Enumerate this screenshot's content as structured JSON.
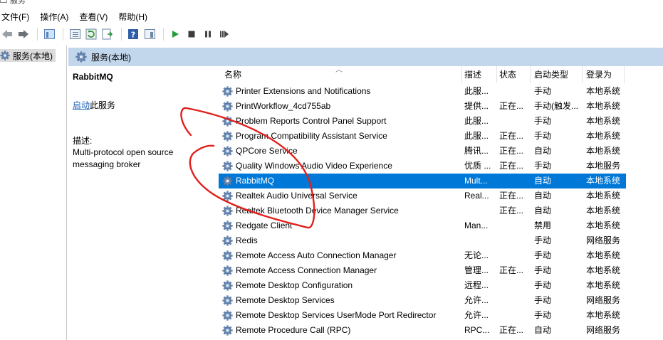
{
  "window": {
    "title_fragment": "服务"
  },
  "menu": [
    {
      "label": "文件(F)"
    },
    {
      "label": "操作(A)"
    },
    {
      "label": "查看(V)"
    },
    {
      "label": "帮助(H)"
    }
  ],
  "toolbar": {
    "buttons": [
      "back-icon",
      "forward-icon",
      "show-hide-tree-icon",
      "properties-icon",
      "refresh-icon",
      "export-list-icon",
      "help-icon",
      "show-action-pane-icon",
      "start-service-icon",
      "stop-service-icon",
      "pause-service-icon",
      "restart-service-icon"
    ]
  },
  "tree": {
    "item_label": "服务(本地)"
  },
  "main": {
    "header_label": "服务(本地)"
  },
  "detail": {
    "service_name": "RabbitMQ",
    "start_link": "启动",
    "start_suffix": "此服务",
    "description_label": "描述:",
    "description": "Multi-protocol open source messaging broker"
  },
  "table": {
    "columns": [
      {
        "label": "名称"
      },
      {
        "label": "描述"
      },
      {
        "label": "状态"
      },
      {
        "label": "启动类型"
      },
      {
        "label": "登录为"
      }
    ],
    "selected_index": 6,
    "rows": [
      {
        "name": "Printer Extensions and Notifications",
        "desc": "此服...",
        "status": "",
        "startup": "手动",
        "logon": "本地系统"
      },
      {
        "name": "PrintWorkflow_4cd755ab",
        "desc": "提供...",
        "status": "正在...",
        "startup": "手动(触发...",
        "logon": "本地系统"
      },
      {
        "name": "Problem Reports Control Panel Support",
        "desc": "此服...",
        "status": "",
        "startup": "手动",
        "logon": "本地系统"
      },
      {
        "name": "Program Compatibility Assistant Service",
        "desc": "此服...",
        "status": "正在...",
        "startup": "手动",
        "logon": "本地系统"
      },
      {
        "name": "QPCore Service",
        "desc": "腾讯...",
        "status": "正在...",
        "startup": "自动",
        "logon": "本地系统"
      },
      {
        "name": "Quality Windows Audio Video Experience",
        "desc": "优质 ...",
        "status": "正在...",
        "startup": "手动",
        "logon": "本地服务"
      },
      {
        "name": "RabbitMQ",
        "desc": "Mult...",
        "status": "",
        "startup": "自动",
        "logon": "本地系统"
      },
      {
        "name": "Realtek Audio Universal Service",
        "desc": "Real...",
        "status": "正在...",
        "startup": "自动",
        "logon": "本地系统"
      },
      {
        "name": "Realtek Bluetooth Device Manager Service",
        "desc": "",
        "status": "正在...",
        "startup": "自动",
        "logon": "本地系统"
      },
      {
        "name": "Redgate Client",
        "desc": "Man...",
        "status": "",
        "startup": "禁用",
        "logon": "本地系统"
      },
      {
        "name": "Redis",
        "desc": "",
        "status": "",
        "startup": "手动",
        "logon": "网络服务"
      },
      {
        "name": "Remote Access Auto Connection Manager",
        "desc": "无论...",
        "status": "",
        "startup": "手动",
        "logon": "本地系统"
      },
      {
        "name": "Remote Access Connection Manager",
        "desc": "管理...",
        "status": "正在...",
        "startup": "手动",
        "logon": "本地系统"
      },
      {
        "name": "Remote Desktop Configuration",
        "desc": "远程...",
        "status": "",
        "startup": "手动",
        "logon": "本地系统"
      },
      {
        "name": "Remote Desktop Services",
        "desc": "允许...",
        "status": "",
        "startup": "手动",
        "logon": "网络服务"
      },
      {
        "name": "Remote Desktop Services UserMode Port Redirector",
        "desc": "允许...",
        "status": "",
        "startup": "手动",
        "logon": "本地系统"
      },
      {
        "name": "Remote Procedure Call (RPC)",
        "desc": "RPC...",
        "status": "正在...",
        "startup": "自动",
        "logon": "网络服务"
      }
    ]
  },
  "colors": {
    "selection": "#0078d7",
    "header_band": "#c2d6ec",
    "annotation": "#e0201d"
  }
}
